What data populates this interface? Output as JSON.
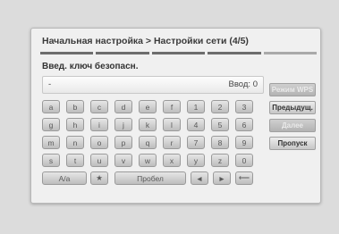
{
  "header": {
    "title": "Начальная настройка > Настройки сети (4/5)"
  },
  "progress": {
    "current": 4,
    "total": 5
  },
  "prompt": "Введ. ключ безопасн.",
  "input": {
    "value": "-",
    "counter": "Ввод: 0"
  },
  "keyboard": {
    "rows": [
      [
        "a",
        "b",
        "c",
        "d",
        "e",
        "f",
        "1",
        "2",
        "3"
      ],
      [
        "g",
        "h",
        "i",
        "j",
        "k",
        "l",
        "4",
        "5",
        "6"
      ],
      [
        "m",
        "n",
        "o",
        "p",
        "q",
        "r",
        "7",
        "8",
        "9"
      ],
      [
        "s",
        "t",
        "u",
        "v",
        "w",
        "x",
        "y",
        "z",
        "0"
      ]
    ],
    "case_toggle": "A/a",
    "star": "★",
    "space": "Пробел",
    "left_arrow": "◄",
    "right_arrow": "►",
    "backspace": "⟵"
  },
  "buttons": {
    "wps": "Режим WPS",
    "prev": "Предыдущ.",
    "next": "Далее",
    "skip": "Пропуск"
  }
}
